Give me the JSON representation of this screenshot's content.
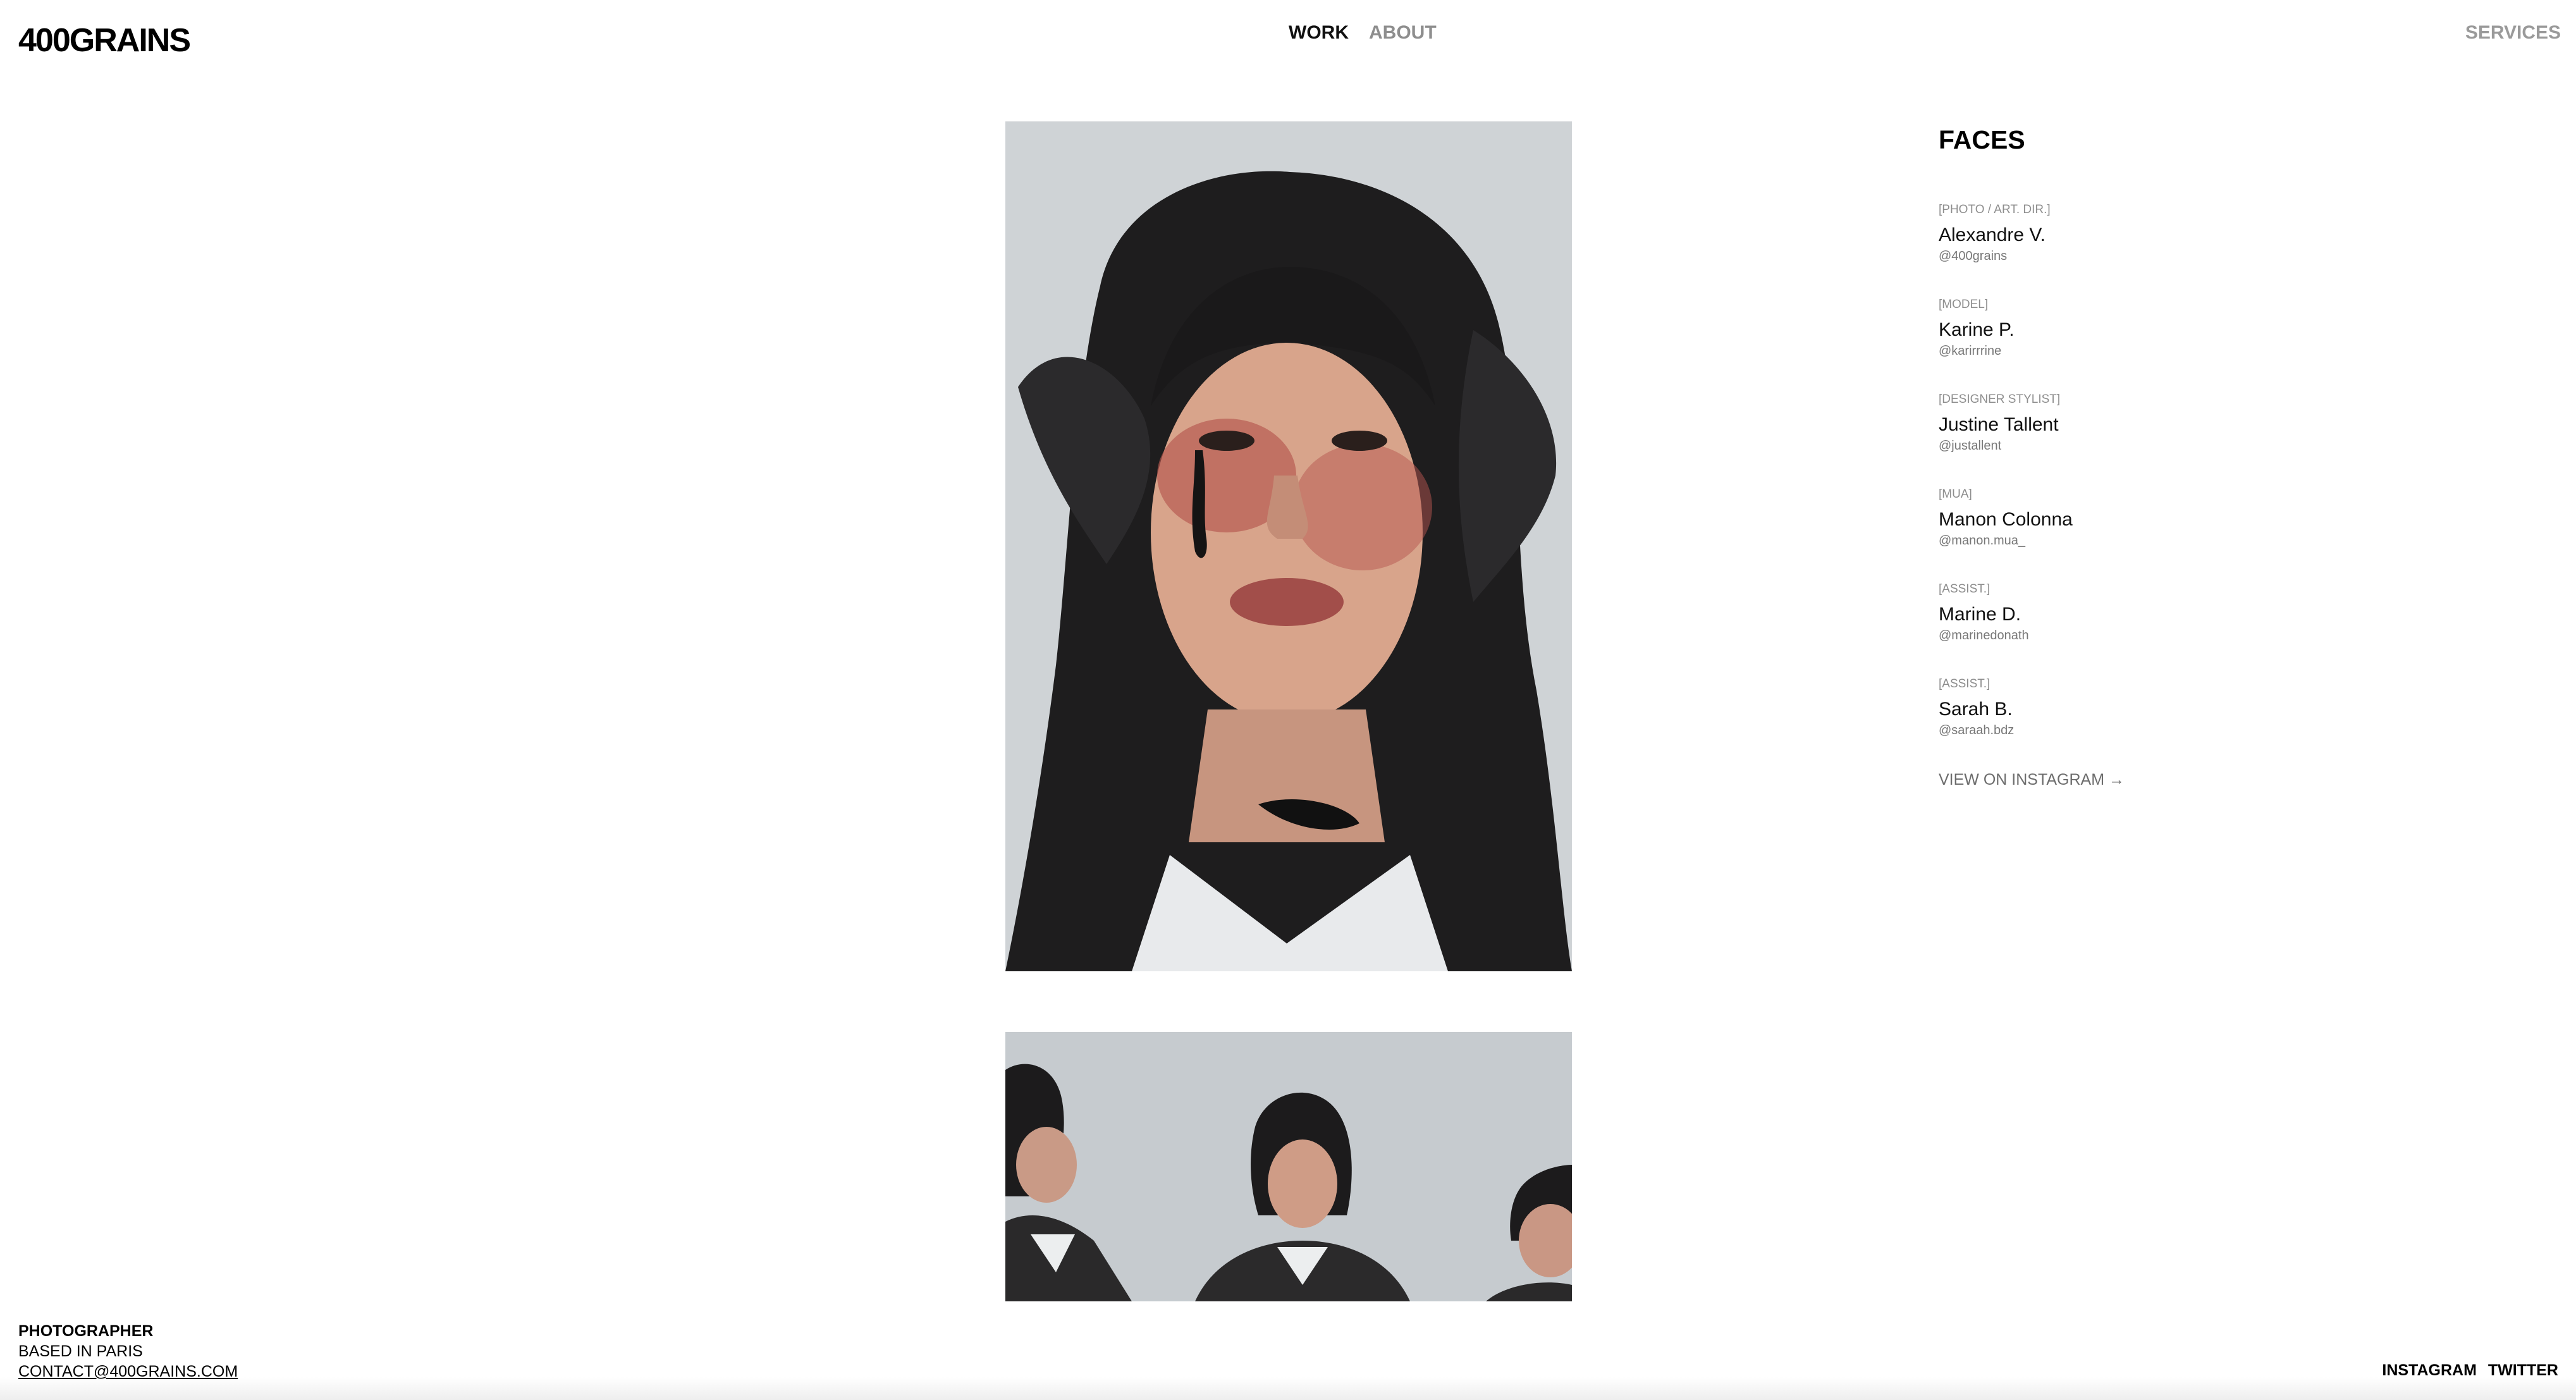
{
  "header": {
    "logo": "400GRAINS",
    "nav": [
      {
        "label": "WORK",
        "active": true
      },
      {
        "label": "ABOUT",
        "active": false
      }
    ],
    "services": "SERVICES"
  },
  "project": {
    "title": "FACES",
    "credits": [
      {
        "role": "[PHOTO / ART. DIR.]",
        "name": "Alexandre V.",
        "handle": "@400grains"
      },
      {
        "role": "[MODEL]",
        "name": "Karine P.",
        "handle": "@karirrrine"
      },
      {
        "role": "[DESIGNER STYLIST]",
        "name": "Justine Tallent",
        "handle": "@justallent"
      },
      {
        "role": "[MUA]",
        "name": "Manon Colonna",
        "handle": "@manon.mua_"
      },
      {
        "role": "[ASSIST.]",
        "name": "Marine D.",
        "handle": "@marinedonath"
      },
      {
        "role": "[ASSIST.]",
        "name": "Sarah B.",
        "handle": "@saraah.bdz"
      }
    ],
    "instagram_link": "VIEW ON INSTAGRAM →"
  },
  "footer": {
    "role": "PHOTOGRAPHER",
    "location": "BASED IN PARIS",
    "contact": "CONTACT@400GRAINS.COM",
    "social": [
      "INSTAGRAM",
      "TWITTER"
    ]
  },
  "colors": {
    "background": "#ffffff",
    "text": "#000000",
    "muted": "#8e8e8e"
  }
}
